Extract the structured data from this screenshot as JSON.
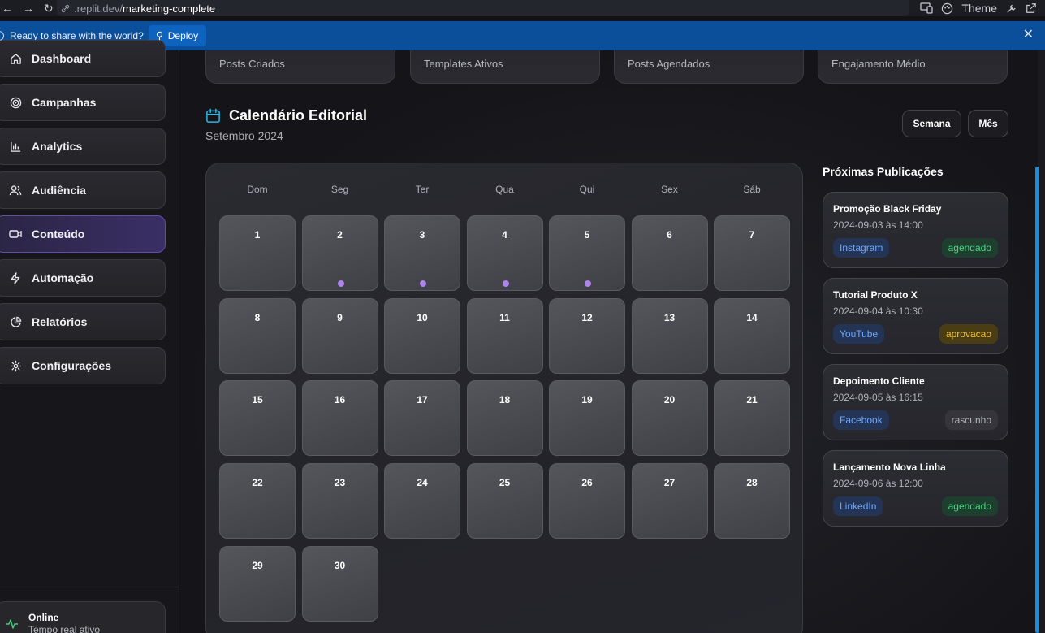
{
  "browser": {
    "url_domain": ".replit.dev/",
    "url_path": "marketing-complete",
    "theme_label": "Theme"
  },
  "banner": {
    "message": "Ready to share with the world?",
    "deploy_label": "Deploy"
  },
  "sidebar": {
    "items": [
      {
        "label": "Dashboard",
        "icon": "home-icon"
      },
      {
        "label": "Campanhas",
        "icon": "target-icon"
      },
      {
        "label": "Analytics",
        "icon": "bar-chart-icon"
      },
      {
        "label": "Audiência",
        "icon": "users-icon"
      },
      {
        "label": "Conteúdo",
        "icon": "video-icon",
        "active": true
      },
      {
        "label": "Automação",
        "icon": "zap-icon"
      },
      {
        "label": "Relatórios",
        "icon": "pie-chart-icon"
      },
      {
        "label": "Configurações",
        "icon": "gear-icon"
      }
    ],
    "status": {
      "title": "Online",
      "subtitle": "Tempo real ativo"
    }
  },
  "stats": [
    "Posts Criados",
    "Templates Ativos",
    "Posts Agendados",
    "Engajamento Médio"
  ],
  "calendar": {
    "title": "Calendário Editorial",
    "subtitle": "Setembro 2024",
    "view_week": "Semana",
    "view_month": "Mês",
    "weekdays": [
      "Dom",
      "Seg",
      "Ter",
      "Qua",
      "Qui",
      "Sex",
      "Sáb"
    ],
    "days": [
      "1",
      "2",
      "3",
      "4",
      "5",
      "6",
      "7",
      "8",
      "9",
      "10",
      "11",
      "12",
      "13",
      "14",
      "15",
      "16",
      "17",
      "18",
      "19",
      "20",
      "21",
      "22",
      "23",
      "24",
      "25",
      "26",
      "27",
      "28",
      "29",
      "30"
    ],
    "days_with_events": [
      "2",
      "3",
      "4",
      "5"
    ],
    "event_dot_color": "#b084f0"
  },
  "upcoming": {
    "title": "Próximas Publicações",
    "items": [
      {
        "title": "Promoção Black Friday",
        "datetime": "2024-09-03 às 14:00",
        "platform": "Instagram",
        "status": "agendado"
      },
      {
        "title": "Tutorial Produto X",
        "datetime": "2024-09-04 às 10:30",
        "platform": "YouTube",
        "status": "aprovacao"
      },
      {
        "title": "Depoimento Cliente",
        "datetime": "2024-09-05 às 16:15",
        "platform": "Facebook",
        "status": "rascunho"
      },
      {
        "title": "Lançamento Nova Linha",
        "datetime": "2024-09-06 às 12:00",
        "platform": "LinkedIn",
        "status": "agendado"
      }
    ]
  }
}
